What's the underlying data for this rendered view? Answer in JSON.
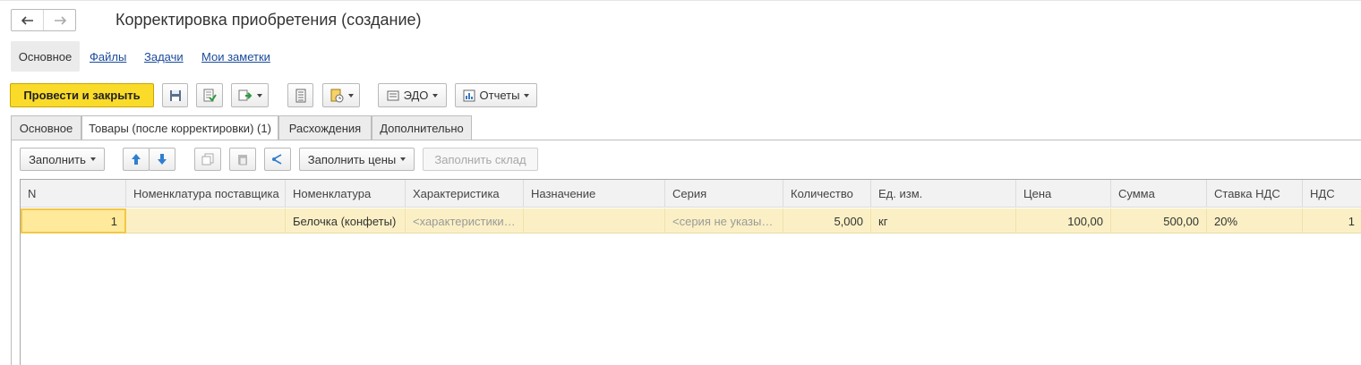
{
  "window": {
    "title": "Корректировка приобретения (создание)"
  },
  "sections": {
    "active": "Основное",
    "links": [
      "Файлы",
      "Задачи",
      "Мои заметки"
    ]
  },
  "toolbar": {
    "post_close": "Провести и закрыть",
    "edo": "ЭДО",
    "reports": "Отчеты"
  },
  "tabs": [
    "Основное",
    "Товары (после корректировки) (1)",
    "Расхождения",
    "Дополнительно"
  ],
  "table_toolbar": {
    "fill": "Заполнить",
    "fill_prices": "Заполнить цены",
    "fill_warehouse": "Заполнить склад"
  },
  "table": {
    "columns": [
      "N",
      "Номенклатура поставщика",
      "Номенклатура",
      "Характеристика",
      "Назначение",
      "Серия",
      "Количество",
      "Ед. изм.",
      "Цена",
      "Сумма",
      "Ставка НДС",
      "НДС"
    ],
    "rows": [
      [
        "1",
        "",
        "Белочка (конфеты)",
        "<характеристики…",
        "",
        "<серия не указы…",
        "5,000",
        "кг",
        "100,00",
        "500,00",
        "20%",
        "1"
      ]
    ]
  },
  "colors": {
    "accent": "#fadb2a",
    "row_highlight": "#fbf0c5",
    "link": "#1a4a9c"
  }
}
